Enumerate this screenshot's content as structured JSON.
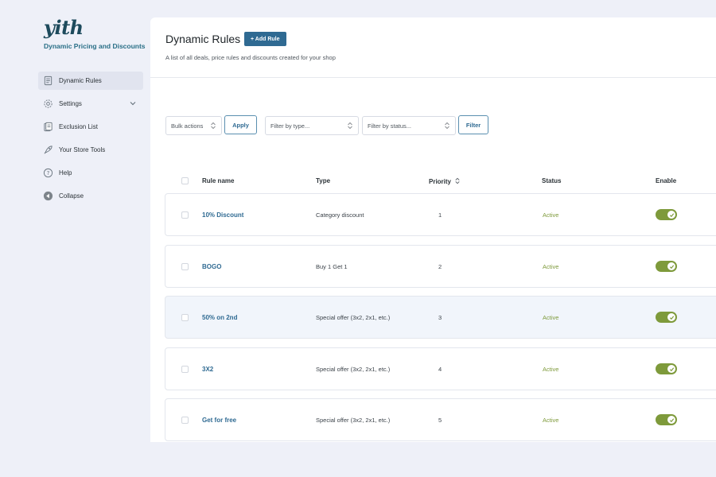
{
  "sidebar": {
    "logo_text": "yith",
    "plugin_name": "Dynamic Pricing and Discounts",
    "items": [
      {
        "label": "Dynamic Rules",
        "icon": "document-icon",
        "active": true
      },
      {
        "label": "Settings",
        "icon": "gear-icon",
        "active": false,
        "has_submenu": true
      },
      {
        "label": "Exclusion List",
        "icon": "list-icon",
        "active": false
      },
      {
        "label": "Your Store Tools",
        "icon": "rocket-icon",
        "active": false
      },
      {
        "label": "Help",
        "icon": "help-icon",
        "active": false
      },
      {
        "label": "Collapse",
        "icon": "collapse-icon",
        "active": false
      }
    ]
  },
  "header": {
    "title": "Dynamic Rules",
    "add_button": "+ Add Rule",
    "subtitle": "A list of all deals, price rules and discounts created for your shop"
  },
  "filters": {
    "bulk_actions": "Bulk actions",
    "apply": "Apply",
    "filter_type": "Filter by type...",
    "filter_status": "Filter by status...",
    "filter": "Filter"
  },
  "table": {
    "columns": [
      "Rule name",
      "Type",
      "Priority",
      "Status",
      "Enable"
    ],
    "rows": [
      {
        "name": "10% Discount",
        "type": "Category discount",
        "priority": "1",
        "status": "Active",
        "enabled": true
      },
      {
        "name": "BOGO",
        "type": "Buy 1 Get 1",
        "priority": "2",
        "status": "Active",
        "enabled": true
      },
      {
        "name": "50% on 2nd",
        "type": "Special offer (3x2, 2x1, etc.)",
        "priority": "3",
        "status": "Active",
        "enabled": true
      },
      {
        "name": "3X2",
        "type": "Special offer (3x2, 2x1, etc.)",
        "priority": "4",
        "status": "Active",
        "enabled": true
      },
      {
        "name": "Get for free",
        "type": "Special offer (3x2, 2x1, etc.)",
        "priority": "5",
        "status": "Active",
        "enabled": true
      }
    ]
  },
  "colors": {
    "accent": "#2f6a92",
    "active_status": "#7e9a3b",
    "background": "#eef0f8"
  }
}
